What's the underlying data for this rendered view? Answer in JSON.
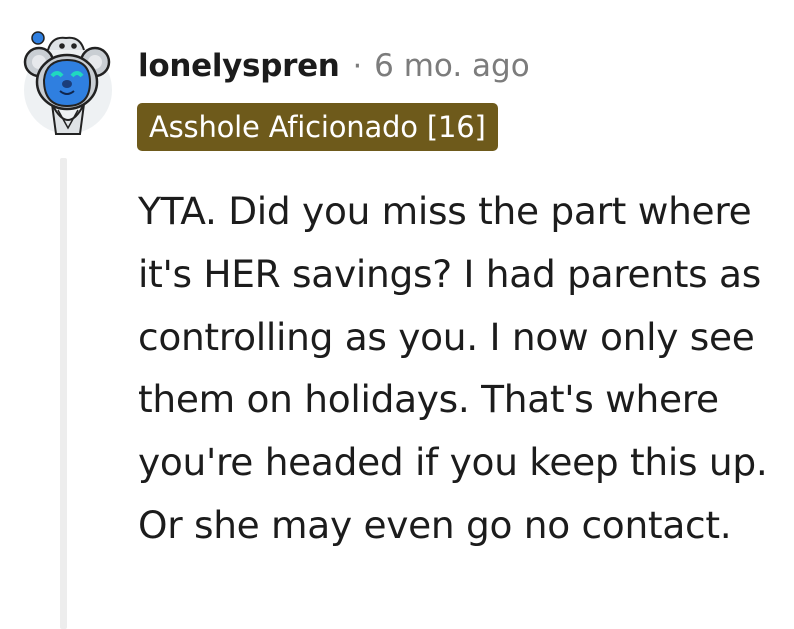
{
  "comment": {
    "author": "lonelyspren",
    "separator": "·",
    "timestamp": "6 mo. ago",
    "flair": "Asshole Aficionado [16]",
    "text": "YTA. Did you miss the part where it's HER savings? I had parents as controlling as you. I now only see them on holidays. That's where you're headed if you keep this up. Or she may even go no contact.",
    "avatar_icon": "snoo-koala-avatar-icon"
  },
  "colors": {
    "flair_background": "#6e5a1b",
    "flair_text": "#ffffff",
    "username": "#1c1c1c",
    "meta": "#7c7c7c",
    "body_text": "#1c1c1c",
    "thread_line": "#ededed",
    "avatar_face": "#2f7fe0"
  }
}
